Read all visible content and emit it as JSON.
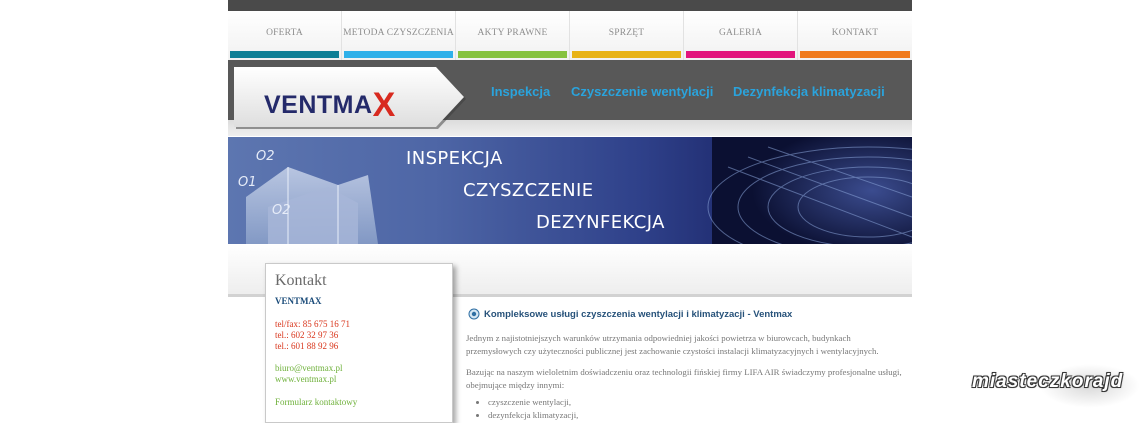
{
  "nav": {
    "items": [
      {
        "label": "OFERTA",
        "color": "#0f7f95"
      },
      {
        "label": "METODA CZYSZCZENIA",
        "color": "#2fb0e9"
      },
      {
        "label": "AKTY PRAWNE",
        "color": "#86c23f"
      },
      {
        "label": "SPRZĘT",
        "color": "#e8b316"
      },
      {
        "label": "GALERIA",
        "color": "#e2157d"
      },
      {
        "label": "KONTAKT",
        "color": "#f07a1c"
      }
    ]
  },
  "header": {
    "logo_main": "VENTMA",
    "logo_x": "X",
    "links": [
      "Inspekcja",
      "Czyszczenie wentylacji",
      "Dezynfekcja klimatyzacji"
    ]
  },
  "banner": {
    "words": [
      "INSPEKCJA",
      "CZYSZCZENIE",
      "DEZYNFEKCJA"
    ],
    "symbols": [
      "O2",
      "O1",
      "O2"
    ]
  },
  "sidebar": {
    "title": "Kontakt",
    "company": "VENTMAX",
    "phones": [
      "tel/fax: 85 675 16 71",
      "tel.: 602 32 97 36",
      "tel.: 601 88 92 96"
    ],
    "email": "biuro@ventmax.pl",
    "website": "www.ventmax.pl",
    "form_link": "Formularz kontaktowy"
  },
  "main": {
    "title": "Kompleksowe usługi czyszczenia wentylacji i klimatyzacji - Ventmax",
    "para1": "Jednym z najistotniejszych warunków utrzymania odpowiedniej jakości powietrza w biurowcach, budynkach przemysłowych czy użyteczności publicznej jest zachowanie czystości instalacji klimatyzacyjnych i wentylacyjnych.",
    "para2": "Bazując na naszym wieloletnim doświadczeniu oraz technologii fińskiej firmy LIFA AIR świadczymy profesjonalne usługi, obejmujące między innymi:",
    "bullets": [
      "czyszczenie wentylacji,",
      "dezynfekcja klimatyzacji,"
    ]
  },
  "watermark": "miasteczkorajd"
}
